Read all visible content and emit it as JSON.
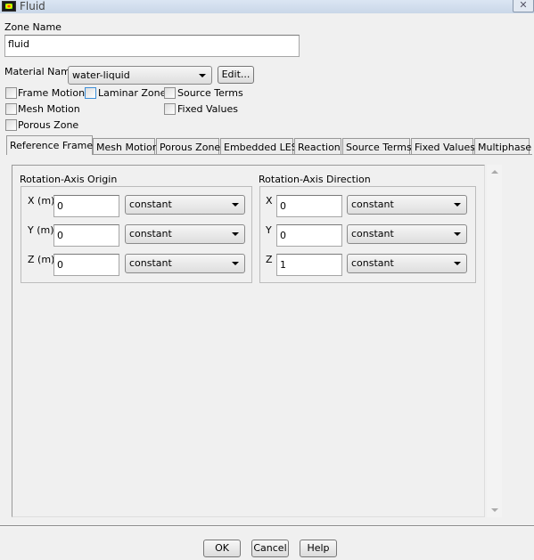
{
  "window": {
    "title": "Fluid",
    "close_icon": "close-icon"
  },
  "zone_name": {
    "label": "Zone Name",
    "value": "fluid"
  },
  "material": {
    "label": "Material Name",
    "value": "water-liquid",
    "edit_label": "Edit..."
  },
  "checkboxes": [
    {
      "label": "Frame Motion",
      "checked": false
    },
    {
      "label": "Laminar Zone",
      "checked": false
    },
    {
      "label": "Source Terms",
      "checked": false
    },
    {
      "label": "Mesh Motion",
      "checked": false
    },
    {
      "label": "Fixed Values",
      "checked": false
    },
    {
      "label": "Porous Zone",
      "checked": false
    }
  ],
  "tabs": [
    {
      "label": "Reference Frame",
      "selected": true
    },
    {
      "label": "Mesh Motion"
    },
    {
      "label": "Porous Zone"
    },
    {
      "label": "Embedded LES"
    },
    {
      "label": "Reaction"
    },
    {
      "label": "Source Terms"
    },
    {
      "label": "Fixed Values"
    },
    {
      "label": "Multiphase"
    }
  ],
  "origin": {
    "title": "Rotation-Axis Origin",
    "rows": [
      {
        "label": "X (m)",
        "value": "0",
        "method": "constant"
      },
      {
        "label": "Y (m)",
        "value": "0",
        "method": "constant"
      },
      {
        "label": "Z (m)",
        "value": "0",
        "method": "constant"
      }
    ]
  },
  "direction": {
    "title": "Rotation-Axis Direction",
    "rows": [
      {
        "label": "X",
        "value": "0",
        "method": "constant"
      },
      {
        "label": "Y",
        "value": "0",
        "method": "constant"
      },
      {
        "label": "Z",
        "value": "1",
        "method": "constant"
      }
    ]
  },
  "buttons": {
    "ok": "OK",
    "cancel": "Cancel",
    "help": "Help"
  }
}
